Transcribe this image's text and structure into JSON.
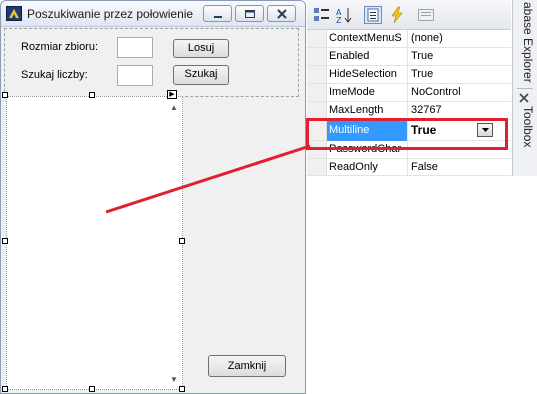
{
  "form": {
    "title": "Poszukiwanie przez połowienie",
    "rozmiar_label": "Rozmiar zbioru:",
    "szukaj_label": "Szukaj liczby:",
    "rozmiar_value": "",
    "szukaj_value": "",
    "losuj_button": "Losuj",
    "szukaj_button": "Szukaj",
    "zamknij_button": "Zamknij",
    "icons": {
      "app": "app-icon",
      "minimize": "minimize-icon",
      "maximize": "maximize-icon",
      "close": "close-icon",
      "smart_tag": "smart-tag-arrow-icon"
    }
  },
  "properties": {
    "toolbar_icons": [
      "categorized-icon",
      "alphabetical-icon",
      "properties-icon",
      "events-icon",
      "property-pages-icon"
    ],
    "rows": [
      {
        "name": "ContextMenuS",
        "value": "(none)"
      },
      {
        "name": "Enabled",
        "value": "True"
      },
      {
        "name": "HideSelection",
        "value": "True"
      },
      {
        "name": "ImeMode",
        "value": "NoControl"
      },
      {
        "name": "MaxLength",
        "value": "32767"
      },
      {
        "name": "Multiline",
        "value": "True"
      },
      {
        "name": "PasswordChar",
        "value": ""
      },
      {
        "name": "ReadOnly",
        "value": "False"
      }
    ],
    "selected_index": 5
  },
  "side_tabs": {
    "database_explorer": "abase Explorer",
    "toolbox": "Toolbox"
  },
  "colors": {
    "selection": "#3399ff",
    "annotation": "#e02030",
    "form_background": "#f0f0f0"
  }
}
